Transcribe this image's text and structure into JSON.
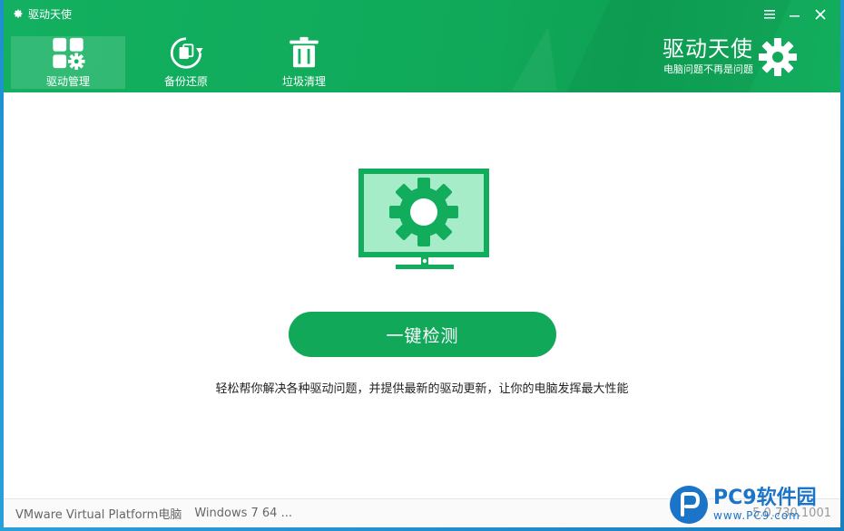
{
  "window": {
    "title": "驱动天使",
    "controls": [
      "menu-icon",
      "minimize-icon",
      "close-icon"
    ]
  },
  "nav": {
    "items": [
      {
        "label": "驱动管理",
        "icon": "driver-manage-icon",
        "active": true
      },
      {
        "label": "备份还原",
        "icon": "backup-restore-icon",
        "active": false
      },
      {
        "label": "垃圾清理",
        "icon": "trash-icon",
        "active": false
      }
    ]
  },
  "brand": {
    "title": "驱动天使",
    "subtitle": "电脑问题不再是问题",
    "icon": "gear-icon"
  },
  "main": {
    "illustration": "monitor-gear-icon",
    "scan_button_label": "一键检测",
    "tagline": "轻松帮你解决各种驱动问题，并提供最新的驱动更新，让你的电脑发挥最大性能"
  },
  "footer": {
    "machine": "VMware Virtual Platform电脑",
    "os": "Windows 7 64 ...",
    "version": "5.0.730.1001"
  },
  "watermark": {
    "brand": "PC9软件园",
    "url": "www.PC9.com"
  },
  "colors": {
    "primary_green": "#11a85a",
    "header_green": "#12b060",
    "monitor_light": "#a6ecc9",
    "desktop_blue": "#2aa0db"
  }
}
